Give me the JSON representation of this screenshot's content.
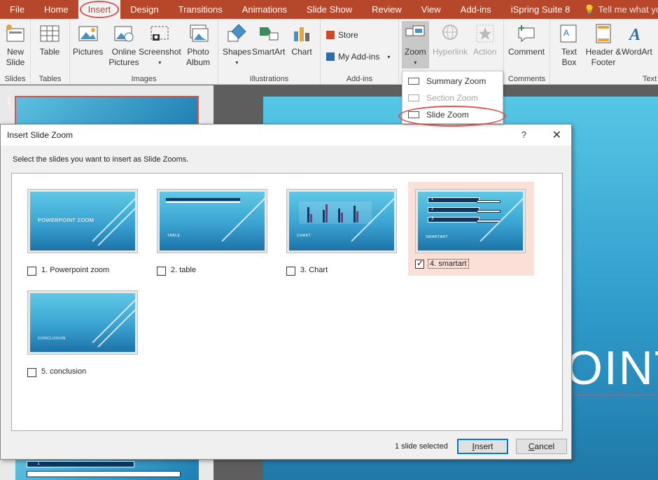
{
  "menu": {
    "items": [
      "File",
      "Home",
      "Insert",
      "Design",
      "Transitions",
      "Animations",
      "Slide Show",
      "Review",
      "View",
      "Add-ins",
      "iSpring Suite 8"
    ],
    "active": "Insert",
    "tell_me": "Tell me what you wa"
  },
  "ribbon": {
    "groups": {
      "slides": "Slides",
      "tables": "Tables",
      "images": "Images",
      "illustrations": "Illustrations",
      "addins": "Add-ins",
      "comments": "Comments",
      "text": "Text"
    },
    "buttons": {
      "new_slide": "New Slide",
      "table": "Table",
      "pictures": "Pictures",
      "online_pictures": "Online Pictures",
      "screenshot": "Screenshot",
      "photo_album": "Photo Album",
      "shapes": "Shapes",
      "smartart": "SmartArt",
      "chart": "Chart",
      "store": "Store",
      "my_addins": "My Add-ins",
      "zoom": "Zoom",
      "hyperlink": "Hyperlink",
      "action": "Action",
      "comment": "Comment",
      "text_box": "Text Box",
      "header_footer": "Header & Footer",
      "wordart": "WordArt"
    }
  },
  "zoom_menu": {
    "summary_zoom": "Summary Zoom",
    "section_zoom": "Section Zoom",
    "slide_zoom": "Slide Zoom"
  },
  "thumbnail_pane": {
    "first_number": "1"
  },
  "slide_canvas": {
    "visible_text": "OINT"
  },
  "dialog": {
    "title": "Insert Slide Zoom",
    "help": "?",
    "close": "✕",
    "instruction": "Select the slides you want to insert as Slide Zooms.",
    "slides": [
      {
        "label": "1. Powerpoint zoom",
        "thumb_title": "POWERPOINT ZOOM",
        "checked": false
      },
      {
        "label": "2. table",
        "thumb_title": "TABLE",
        "checked": false
      },
      {
        "label": "3. Chart",
        "thumb_title": "CHART",
        "checked": false
      },
      {
        "label": "4. smartart",
        "thumb_title": "SMARTART",
        "checked": true
      },
      {
        "label": "5. conclusion",
        "thumb_title": "CONCLUSION",
        "checked": false
      }
    ],
    "smartart_items": [
      "1",
      "2",
      "3"
    ],
    "status": "1 slide selected",
    "insert": "Insert",
    "cancel": "Cancel"
  },
  "colors": {
    "menubar": "#b7472a",
    "ribbon": "#f2f2f2",
    "highlight_circle": "#d9534f",
    "selected_card": "#fbe0d8",
    "primary_button_border": "#0078d7",
    "slide_blue": "#2f9ccb"
  }
}
